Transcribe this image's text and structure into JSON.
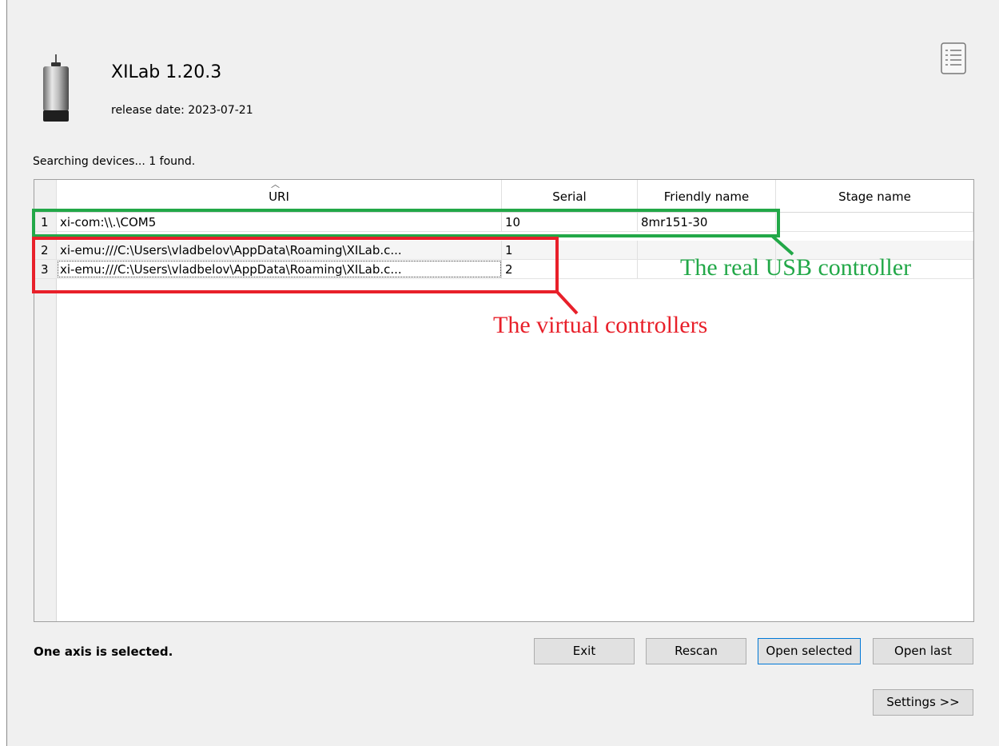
{
  "app": {
    "title": "XILab 1.20.3",
    "release_date": "release date: 2023-07-21"
  },
  "status": {
    "search": "Searching devices... 1 found.",
    "selection": "One axis is selected."
  },
  "table": {
    "columns": [
      "URI",
      "Serial",
      "Friendly name",
      "Stage name"
    ],
    "sort_indicator": "︿",
    "rows": [
      {
        "num": "1",
        "uri": "xi-com:\\\\.\\COM5",
        "serial": "10",
        "friendly": "8mr151-30",
        "stage": ""
      },
      {
        "num": "2",
        "uri": "xi-emu:///C:\\Users\\vladbelov\\AppData\\Roaming\\XILab.c...",
        "serial": "1",
        "friendly": "",
        "stage": ""
      },
      {
        "num": "3",
        "uri": "xi-emu:///C:\\Users\\vladbelov\\AppData\\Roaming\\XILab.c...",
        "serial": "2",
        "friendly": "",
        "stage": ""
      }
    ]
  },
  "buttons": {
    "exit": "Exit",
    "rescan": "Rescan",
    "open_selected": "Open selected",
    "open_last": "Open last",
    "settings": "Settings >>"
  },
  "annotations": {
    "real": "The real USB controller",
    "virtual": "The virtual controllers",
    "real_color": "#22a848",
    "virtual_color": "#e8202a"
  },
  "icons": {
    "device": "motor-controller-icon",
    "details": "details-list-icon"
  }
}
